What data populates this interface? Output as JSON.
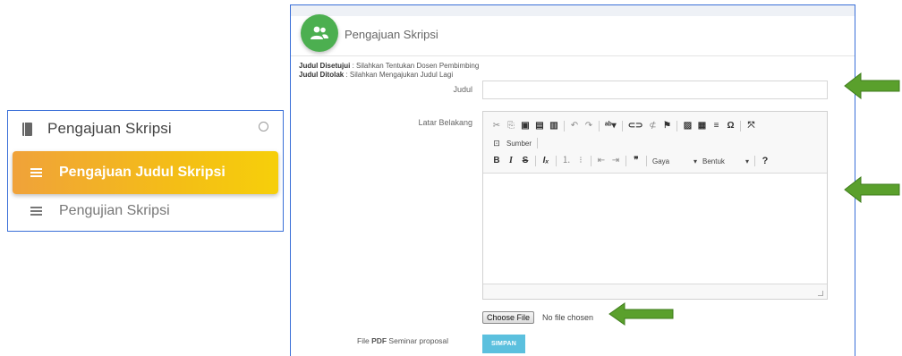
{
  "sidebar": {
    "header_label": "Pengajuan Skripsi",
    "header_icon": "book-icon",
    "header_toggle_icon": "circle-icon",
    "items": [
      {
        "label": "Pengajuan Judul Skripsi",
        "icon": "list-icon",
        "active": true
      },
      {
        "label": "Pengujian Skripsi",
        "icon": "list-icon",
        "active": false
      }
    ],
    "active_gradient": [
      "#f0a23a",
      "#f6cf0a"
    ]
  },
  "card": {
    "icon": "users-icon",
    "icon_color": "#4caf50",
    "title": "Pengajuan Skripsi"
  },
  "notes": {
    "approved_label": "Judul Disetujui",
    "approved_text": " : Silahkan Tentukan Dosen Pembimbing",
    "rejected_label": "Judul Ditolak",
    "rejected_text": " : Silahkan Mengajukan Judul Lagi"
  },
  "form": {
    "judul_label": "Judul",
    "judul_value": "",
    "latar_label": "Latar Belakang",
    "editor": {
      "source_label": "Sumber",
      "style_combo": "Gaya",
      "format_combo": "Bentuk",
      "help": "?"
    },
    "file_label_prefix": "File ",
    "file_label_bold": "PDF",
    "file_label_suffix": " Seminar proposal",
    "file_button": "Choose File",
    "file_status": "No file chosen",
    "submit_label": "SIMPAN"
  },
  "colors": {
    "border_highlight": "#3a6fd8",
    "arrow": "#5aa02c",
    "submit": "#5bc0de"
  }
}
